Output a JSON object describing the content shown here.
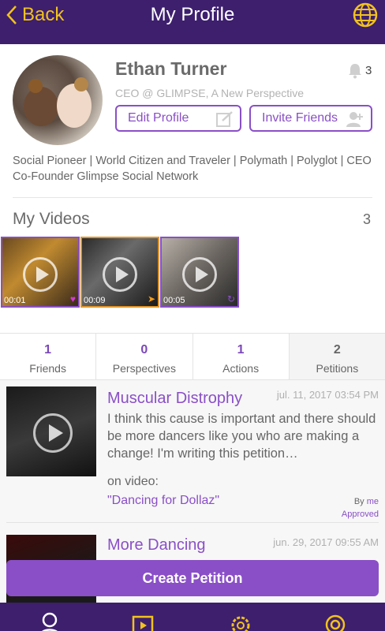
{
  "header": {
    "back_label": "Back",
    "title": "My Profile"
  },
  "profile": {
    "name": "Ethan Turner",
    "notification_count": "3",
    "tagline": "CEO @ GLIMPSE, A New Perspective",
    "edit_label": "Edit Profile",
    "invite_label": "Invite Friends",
    "bio": "Social Pioneer | World Citizen and Traveler | Polymath | Polyglot | CEO Co-Founder Glimpse Social Network"
  },
  "videos": {
    "title": "My Videos",
    "count": "3",
    "items": [
      {
        "duration": "00:01"
      },
      {
        "duration": "00:09"
      },
      {
        "duration": "00:05"
      }
    ]
  },
  "stats": [
    {
      "value": "1",
      "label": "Friends"
    },
    {
      "value": "0",
      "label": "Perspectives"
    },
    {
      "value": "1",
      "label": "Actions"
    },
    {
      "value": "2",
      "label": "Petitions"
    }
  ],
  "petitions": [
    {
      "title": "Muscular Distrophy",
      "date": "jul. 11, 2017 03:54 PM",
      "body": "I think this cause is important and there should be more dancers like you who are making a change! I'm writing this petition…",
      "on_video_label": "on video:",
      "video_title": "\"Dancing for Dollaz\"",
      "by_label": "By",
      "by_user": "me",
      "status": "Approved"
    },
    {
      "title": "More Dancing",
      "date": "jun. 29, 2017 09:55 AM"
    }
  ],
  "actions": {
    "create_label": "Create Petition"
  },
  "colors": {
    "header_bg": "#3d1f6e",
    "accent": "#8a4fc7",
    "gold": "#f2c21b"
  }
}
